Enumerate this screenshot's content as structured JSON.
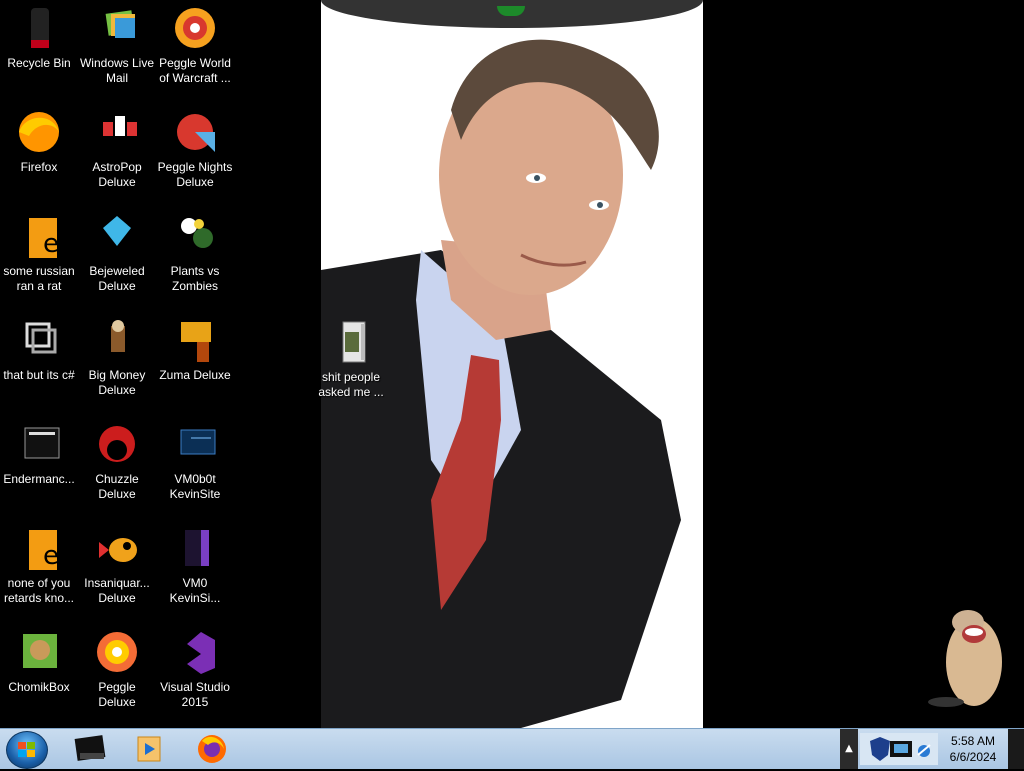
{
  "desktop": {
    "icons": [
      {
        "label": "Recycle Bin",
        "icon": "recycle-bin-icon"
      },
      {
        "label": "Windows Live\nMail",
        "icon": "windows-live-mail-icon"
      },
      {
        "label": "Peggle World\nof Warcraft ...",
        "icon": "peggle-wow-icon"
      },
      {
        "label": "Firefox",
        "icon": "firefox-icon"
      },
      {
        "label": "AstroPop\nDeluxe",
        "icon": "astropop-icon"
      },
      {
        "label": "Peggle Nights\nDeluxe",
        "icon": "peggle-nights-icon"
      },
      {
        "label": "some russian\nran a rat",
        "icon": "program-icon"
      },
      {
        "label": "Bejeweled\nDeluxe",
        "icon": "bejeweled-icon"
      },
      {
        "label": "Plants vs\nZombies",
        "icon": "plants-vs-zombies-icon"
      },
      {
        "label": "that but its c#",
        "icon": "shortcut-icon"
      },
      {
        "label": "Big Money\nDeluxe",
        "icon": "big-money-icon"
      },
      {
        "label": "Zuma Deluxe",
        "icon": "zuma-icon"
      },
      {
        "label": "Endermanc...",
        "icon": "console-icon"
      },
      {
        "label": "Chuzzle\nDeluxe",
        "icon": "chuzzle-icon"
      },
      {
        "label": "VM0b0t\nKevinSite",
        "icon": "vm-icon"
      },
      {
        "label": "none of you\nretards kno...",
        "icon": "program-icon"
      },
      {
        "label": "Insaniquar...\nDeluxe",
        "icon": "insaniquarium-icon"
      },
      {
        "label": "VM0\nKevinSi...",
        "icon": "file-icon"
      },
      {
        "label": "ChomikBox",
        "icon": "chomikbox-icon"
      },
      {
        "label": "Peggle Deluxe",
        "icon": "peggle-icon"
      },
      {
        "label": "Visual Studio\n2015",
        "icon": "visual-studio-icon"
      }
    ],
    "folder": {
      "label": "shit people\nasked me ...",
      "icon": "folder-icon"
    }
  },
  "taskbar": {
    "pinned": [
      "explorer-icon",
      "media-player-icon",
      "firefox-icon"
    ],
    "clock": {
      "time": "5:58 AM",
      "date": "6/6/2024"
    },
    "tray_toggle": "▲"
  }
}
